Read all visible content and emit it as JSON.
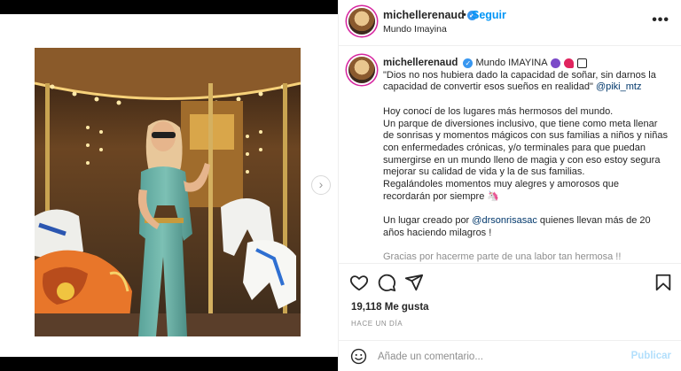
{
  "post": {
    "username": "michellerenaud",
    "verified_mark": "✓",
    "separator": "•",
    "follow_label": "Seguir",
    "location": "Mundo Imayina",
    "more_icon": "more-options-icon"
  },
  "caption": {
    "username": "michellerenaud",
    "title": "Mundo IMAYINA",
    "quote": "\"Dios no nos hubiera dado la capacidad de soñar, sin darnos la capacidad de convertir esos sueños en realidad\"",
    "quote_mention": "@piki_mtz",
    "paragraph1": "Hoy conocí de los lugares más hermosos del mundo.",
    "paragraph2": "Un parque de diversiones inclusivo, que tiene como meta llenar de sonrisas y momentos mágicos con sus familias a niños y niñas con enfermedades crónicas, y/o terminales para que puedan sumergirse en un mundo lleno de magia y con eso estoy segura mejorar su calidad de vida y la de sus familias.",
    "paragraph3": "Regalándoles momentos muy alegres y amorosos que recordarán por siempre",
    "emoji_end": "🦄",
    "para4_before": "Un lugar creado por",
    "para4_mention": "@drsonrisasac",
    "para4_after": "quienes llevan más de 20 años haciendo milagros !",
    "cut_line": "Gracias por hacerme parte de una labor tan hermosa !!"
  },
  "actions": {
    "like_icon": "heart-icon",
    "comment_icon": "comment-icon",
    "share_icon": "share-icon",
    "save_icon": "bookmark-icon"
  },
  "likes": "19,118 Me gusta",
  "time_ago": "HACE UN DÍA",
  "comment_box": {
    "placeholder": "Añade un comentario...",
    "publish_label": "Publicar",
    "emoji_icon": "emoji-icon"
  },
  "media": {
    "next_glyph": "›"
  },
  "colors": {
    "accent": "#0095f6",
    "publish_disabled": "#b2dffc",
    "verified": "#3897f0"
  }
}
